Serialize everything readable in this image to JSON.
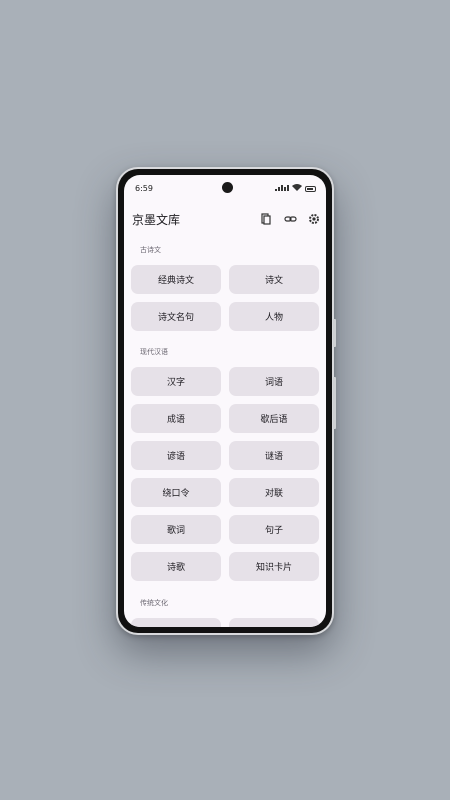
{
  "status_bar": {
    "time": "6:59",
    "icons": [
      "signal-icon",
      "wifi-icon",
      "battery-icon"
    ]
  },
  "app_bar": {
    "title": "京墨文库",
    "actions": [
      "bookmark-icon",
      "link-icon",
      "settings-icon"
    ]
  },
  "sections": [
    {
      "label": "古诗文",
      "items": [
        "经典诗文",
        "诗文",
        "诗文名句",
        "人物"
      ]
    },
    {
      "label": "现代汉语",
      "items": [
        "汉字",
        "词语",
        "成语",
        "歇后语",
        "谚语",
        "谜语",
        "绕口令",
        "对联",
        "歌词",
        "句子",
        "诗歌",
        "知识卡片"
      ]
    },
    {
      "label": "传统文化",
      "items": [
        "",
        ""
      ]
    }
  ],
  "colors": {
    "background": "#a9b0b8",
    "screen": "#fbf8fc",
    "tile": "#e6e1e8",
    "text": "#1d1b20"
  }
}
